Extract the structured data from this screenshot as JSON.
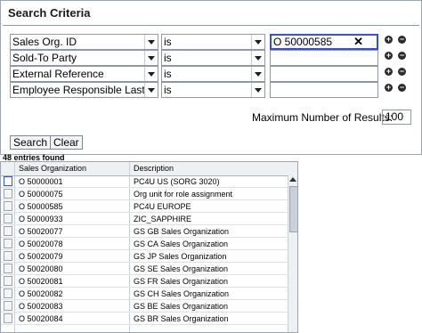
{
  "panel": {
    "title": "Search Criteria"
  },
  "criteria": [
    {
      "field": "Sales Org. ID",
      "operator": "is",
      "value": "O 50000585",
      "clear": "✕"
    },
    {
      "field": "Sold-To Party",
      "operator": "is",
      "value": ""
    },
    {
      "field": "External Reference",
      "operator": "is",
      "value": ""
    },
    {
      "field": "Employee Responsible Last Na",
      "operator": "is",
      "value": ""
    }
  ],
  "max_results": {
    "label": "Maximum Number of Results:",
    "value": "100"
  },
  "buttons": {
    "search": "Search",
    "clear": "Clear"
  },
  "result_count": "48 entries found",
  "table": {
    "headers": [
      "Sales Organization",
      "Description"
    ],
    "rows": [
      [
        "O 50000001",
        "PC4U US (SORG 3020)"
      ],
      [
        "O 50000075",
        "Org unit for role assignment"
      ],
      [
        "O 50000585",
        "PC4U EUROPE"
      ],
      [
        "O 50000933",
        "ZIC_SAPPHIRE"
      ],
      [
        "O 50020077",
        "GS GB Sales Organization"
      ],
      [
        "O 50020078",
        "GS CA Sales Organization"
      ],
      [
        "O 50020079",
        "GS JP Sales Organization"
      ],
      [
        "O 50020080",
        "GS SE Sales Organization"
      ],
      [
        "O 50020081",
        "GS FR Sales Organization"
      ],
      [
        "O 50020082",
        "GS CH Sales Organization"
      ],
      [
        "O 50020083",
        "GS BE Sales Organization"
      ],
      [
        "O 50020084",
        "GS BR Sales Organization"
      ]
    ]
  },
  "icons": {
    "add": "+",
    "remove": "−"
  }
}
